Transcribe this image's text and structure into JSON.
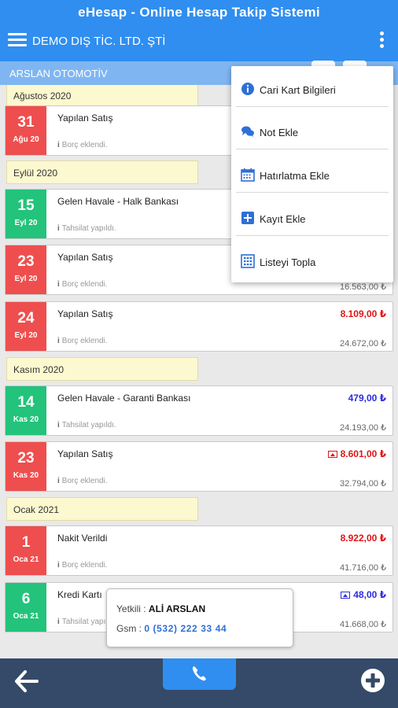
{
  "app": {
    "title": "eHesap - Online Hesap Takip Sistemi",
    "company": "DEMO DIŞ TİC. LTD. ŞTİ"
  },
  "account": {
    "name": "ARSLAN OTOMOTİV"
  },
  "groups": {
    "g0": "Ağustos 2020",
    "g1": "Eylül 2020",
    "g2": "Kasım 2020",
    "g3": "Ocak 2021"
  },
  "transactions": [
    {
      "day": "31",
      "month": "Ağu 20",
      "title": "Yapılan Satış",
      "note": "Borç eklendi.",
      "amount": "",
      "balance": "",
      "type": "debit"
    },
    {
      "day": "15",
      "month": "Eyl 20",
      "title": "Gelen Havale - Halk Bankası",
      "note": "Tahsilat yapıldı.",
      "amount": "",
      "balance": "",
      "type": "credit"
    },
    {
      "day": "23",
      "month": "Eyl 20",
      "title": "Yapılan Satış",
      "note": "Borç eklendi.",
      "amount": "",
      "balance": "16.563,00 ₺",
      "type": "debit"
    },
    {
      "day": "24",
      "month": "Eyl 20",
      "title": "Yapılan Satış",
      "note": "Borç eklendi.",
      "amount": "8.109,00 ₺",
      "balance": "24.672,00 ₺",
      "type": "debit"
    },
    {
      "day": "14",
      "month": "Kas 20",
      "title": "Gelen Havale - Garanti Bankası",
      "note": "Tahsilat yapıldı.",
      "amount": "479,00 ₺",
      "balance": "24.193,00 ₺",
      "type": "credit"
    },
    {
      "day": "23",
      "month": "Kas 20",
      "title": "Yapılan Satış",
      "note": "Borç eklendi.",
      "amount": "8.601,00 ₺",
      "balance": "32.794,00 ₺",
      "type": "debit",
      "has_image": true
    },
    {
      "day": "1",
      "month": "Oca 21",
      "title": "Nakit Verildi",
      "note": "Borç eklendi.",
      "amount": "8.922,00 ₺",
      "balance": "41.716,00 ₺",
      "type": "debit"
    },
    {
      "day": "6",
      "month": "Oca 21",
      "title": "Kredi Kartı",
      "note": "Tahsilat yapıldı.",
      "amount": "48,00 ₺",
      "balance": "41.668,00 ₺",
      "type": "credit",
      "has_image": true
    }
  ],
  "menu": {
    "items": [
      {
        "label": "Cari Kart Bilgileri",
        "icon": "info-icon"
      },
      {
        "label": "Not Ekle",
        "icon": "chat-bubbles-icon"
      },
      {
        "label": "Hatırlatma Ekle",
        "icon": "calendar-icon"
      },
      {
        "label": "Kayıt Ekle",
        "icon": "plus-square-icon"
      },
      {
        "label": "Listeyi Topla",
        "icon": "calculator-icon"
      }
    ]
  },
  "contact": {
    "label": "Yetkili :",
    "name": "ALİ ARSLAN",
    "gsm_label": "Gsm :",
    "phone": "0 (532) 222 33 44"
  },
  "colors": {
    "primary": "#2f8ef0",
    "debit": "#ef4e4e",
    "credit": "#23c37b",
    "bottom_bar": "#344a68",
    "group_header": "#fcf8cf"
  }
}
